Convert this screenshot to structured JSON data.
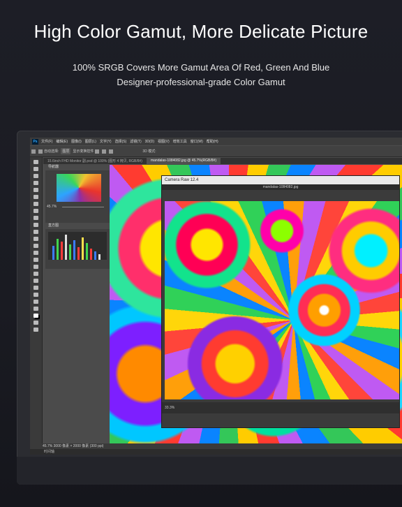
{
  "headline": "High Color Gamut, More Delicate Picture",
  "subline1": "100% SRGB Covers More Gamut Area Of Red, Green And Blue",
  "subline2": "Designer-professional-grade Color Gamut",
  "app": {
    "logo": "Ps",
    "menu": [
      "文件(F)",
      "编辑(E)",
      "图像(I)",
      "图层(L)",
      "文字(Y)",
      "选择(S)",
      "滤镜(T)",
      "3D(D)",
      "视图(V)",
      "增效工具",
      "窗口(W)",
      "帮助(H)"
    ],
    "options": {
      "auto_select": "自动选择:",
      "layer": "图层",
      "show_transform": "显示变换控件",
      "mode_3d": "3D 模式:"
    },
    "tabs": [
      "15.6inch FHD Monitor 副.psd @ 100% (图形 4 拷贝, RGB/8#)",
      "mandalas-1084082.jpg @ 45.7%(RGB/8#)"
    ],
    "navigator_title": "导航器",
    "nav_zoom": "45.7%",
    "histogram_title": "直方图",
    "camera_raw": {
      "title": "Camera Raw 12.4",
      "filename": "mandalas-1084082.jpg",
      "zoom": "33.3%"
    },
    "status": "45.7%    3000 像素 × 2000 像素 (300 ppi)",
    "timeline": "时间轴"
  },
  "colors": {
    "accent": "#31a8ff",
    "bg": "#1d1e26"
  }
}
